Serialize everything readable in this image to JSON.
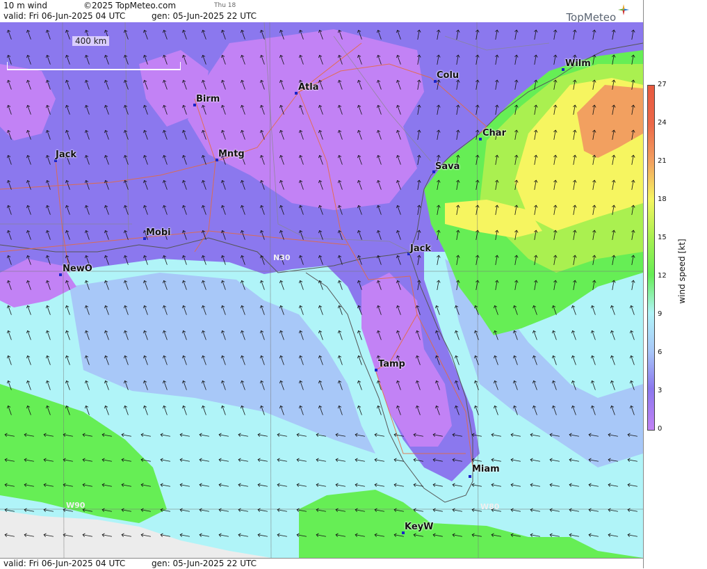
{
  "header": {
    "product": "10 m wind",
    "copyright": "©2025 TopMeteo.com",
    "forecast_day": "Thu 18",
    "valid": "valid:  Fri  06-Jun-2025  04 UTC",
    "generated": "gen: 05-Jun-2025 22 UTC",
    "brand": "TopMeteo"
  },
  "footer": {
    "valid": "valid:  Fri  06-Jun-2025  04 UTC",
    "generated": "gen: 05-Jun-2025 22 UTC"
  },
  "scale_bar": {
    "label": "400 km"
  },
  "grid_labels": [
    "N30",
    "W90",
    "W80"
  ],
  "cities": [
    {
      "name": "Wilm"
    },
    {
      "name": "Colu"
    },
    {
      "name": "Atla"
    },
    {
      "name": "Birm"
    },
    {
      "name": "Char"
    },
    {
      "name": "Sava"
    },
    {
      "name": "Jack"
    },
    {
      "name": "Mntg"
    },
    {
      "name": "Mobi"
    },
    {
      "name": "Jack"
    },
    {
      "name": "NewO"
    },
    {
      "name": "Tamp"
    },
    {
      "name": "Miam"
    },
    {
      "name": "KeyW"
    }
  ],
  "legend": {
    "title": "wind speed [kt]",
    "ticks": [
      "27",
      "24",
      "21",
      "18",
      "15",
      "12",
      "9",
      "6",
      "3",
      "0"
    ],
    "colors": {
      "0": "#c282f5",
      "3": "#8b78ee",
      "6": "#a8c8f8",
      "9": "#b0f4f8",
      "12": "#66ee55",
      "15": "#aaf050",
      "18": "#f6f560",
      "21": "#f2a060",
      "24": "#ec6848",
      "27": "#e85a40"
    }
  }
}
